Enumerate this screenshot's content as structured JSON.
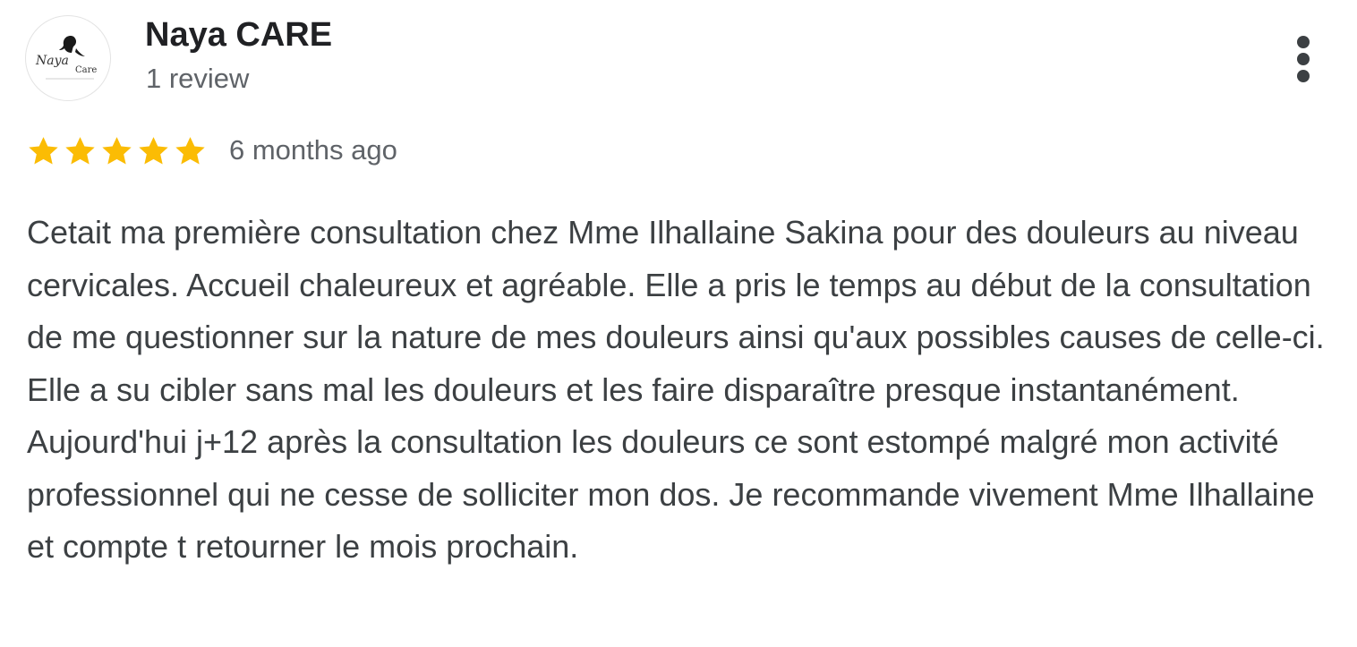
{
  "reviewer": {
    "name": "Naya CARE",
    "review_count": "1 review",
    "avatar": {
      "icon": "naya-care-logo",
      "logo_text_primary": "Naya",
      "logo_text_secondary": "Care"
    }
  },
  "menu": {
    "icon": "more-vert-icon"
  },
  "review": {
    "rating": 5,
    "rating_max": 5,
    "star_color": "#fbbc04",
    "timestamp": "6 months ago",
    "text": "Cetait ma première consultation chez Mme Ilhallaine Sakina pour des douleurs au niveau cervicales. Accueil chaleureux et agréable. Elle a pris le temps au début de la consultation de me questionner sur la nature de mes douleurs ainsi qu'aux possibles causes de celle-ci. Elle a su cibler sans mal les douleurs et les faire disparaître presque instantanément. Aujourd'hui j+12 après la consultation les douleurs ce sont estompé malgré mon activité professionnel qui ne cesse de solliciter mon dos. Je recommande vivement Mme Ilhallaine et compte t retourner le mois prochain."
  }
}
